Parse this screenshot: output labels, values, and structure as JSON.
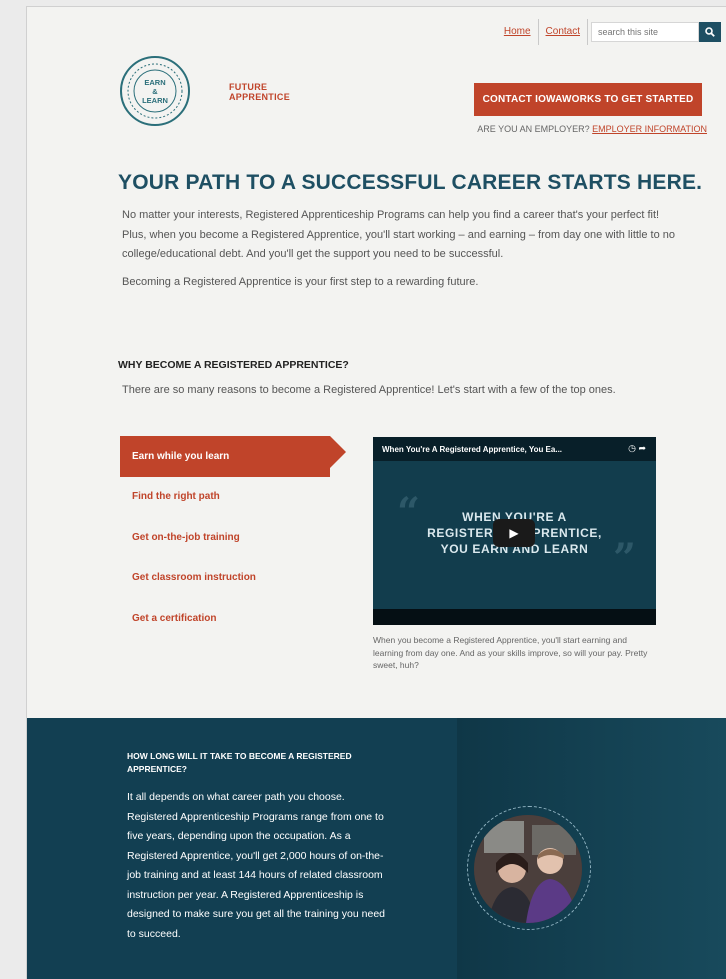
{
  "nav": {
    "home": "Home",
    "contact": "Contact",
    "search_placeholder": "search this site"
  },
  "brand": {
    "logo_top": "EARN",
    "logo_mid": "&",
    "logo_bottom": "LEARN",
    "line1": "FUTURE",
    "line2": "APPRENTICE"
  },
  "cta": {
    "label": "CONTACT IOWAWORKS TO GET STARTED",
    "employer_prompt": "ARE YOU AN EMPLOYER?",
    "employer_link": "EMPLOYER INFORMATION"
  },
  "hero": {
    "title": "YOUR PATH TO A SUCCESSFUL CAREER STARTS HERE.",
    "p1": "No matter your interests, Registered Apprenticeship Programs can help you find a career that's your perfect fit! Plus, when you become a Registered Apprentice, you'll start working – and earning – from day one with little to no college/educational debt. And you'll get the support you need to be successful.",
    "p2": "Becoming a Registered Apprentice is your first step to a rewarding future."
  },
  "why": {
    "heading": "WHY BECOME A REGISTERED APPRENTICE?",
    "text": "There are so many reasons to become a Registered Apprentice! Let's start with a few of the top ones."
  },
  "tabs": [
    {
      "label": "Earn while you learn",
      "active": true
    },
    {
      "label": "Find the right path",
      "active": false
    },
    {
      "label": "Get on-the-job training",
      "active": false
    },
    {
      "label": "Get classroom instruction",
      "active": false
    },
    {
      "label": "Get a certification",
      "active": false
    }
  ],
  "video": {
    "title": "When You're A Registered Apprentice, You Ea...",
    "line1": "WHEN YOU'RE A",
    "line2": "REGISTERED APPRENTICE,",
    "line3": "YOU EARN AND LEARN",
    "caption": "When you become a Registered Apprentice, you'll start earning and learning from day one. And as your skills improve, so will your pay. Pretty sweet, huh?"
  },
  "howlong": {
    "heading": "HOW LONG WILL IT TAKE TO BECOME A REGISTERED APPRENTICE?",
    "body": "It all depends on what career path you choose. Registered Apprenticeship Programs range from one to five years, depending upon the occupation. As a Registered Apprentice, you'll get 2,000 hours of on-the-job training and at least 144 hours of related classroom instruction per year. A Registered Apprenticeship is designed to make sure you get all the training you need to succeed."
  },
  "colors": {
    "accent": "#c0442a",
    "navy": "#1e4f63",
    "dark_section": "#123f52"
  }
}
